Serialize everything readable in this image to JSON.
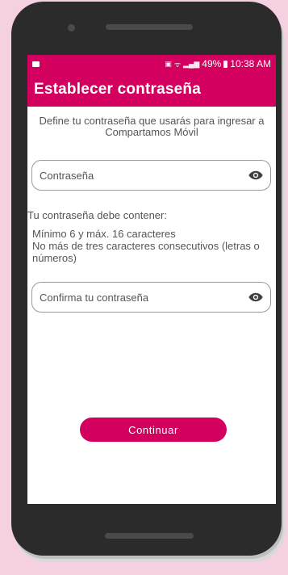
{
  "status_bar": {
    "time": "10:38 AM",
    "battery": "49%"
  },
  "header": {
    "title": "Establecer contraseña"
  },
  "intro_text": "Define tu contraseña que usarás para ingresar a Compartamos Móvil",
  "password_field": {
    "placeholder": "Contraseña"
  },
  "rules": {
    "title": "Tu contraseña debe contener:",
    "items": [
      "Mínimo 6 y máx. 16 caracteres",
      "No más de tres caracteres consecutivos (letras o números)"
    ]
  },
  "confirm_field": {
    "placeholder": "Confirma tu contraseña"
  },
  "continue_button": {
    "label": "Continuar"
  },
  "colors": {
    "brand": "#d4005f",
    "background": "#f4d0e1"
  },
  "icons": {
    "visibility": "eye-icon",
    "signal": "signal-icon",
    "battery": "battery-icon",
    "notification": "video-icon"
  }
}
